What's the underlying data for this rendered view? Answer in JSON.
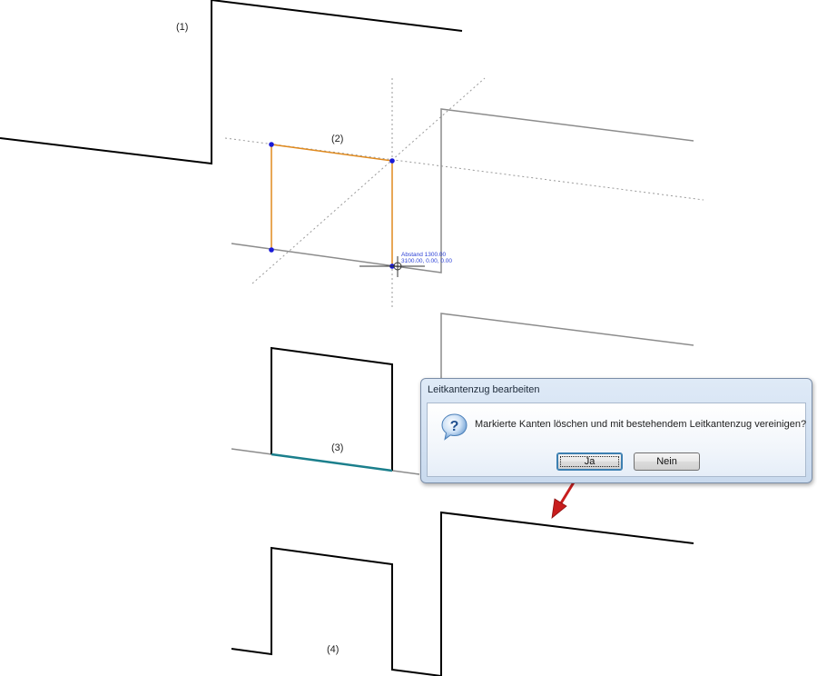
{
  "steps": {
    "step1": "(1)",
    "step2": "(2)",
    "step3": "(3)",
    "step4": "(4)"
  },
  "coordinate_tooltip": {
    "line1": "Abstand 1300.00",
    "line2": "3100.00, 0.00, 0.00"
  },
  "dialog": {
    "title": "Leitkantenzug bearbeiten",
    "message": "Markierte Kanten löschen und mit bestehendem Leitkantenzug vereinigen?",
    "icon": "question-icon",
    "yes_label": "Ja",
    "no_label": "Nein",
    "focused_button": "yes"
  },
  "colors": {
    "edge": "#000000",
    "reference_edge": "#8c8c8c",
    "selected_edge": "#e08a1e",
    "marked_edge": "#1b7f8c",
    "vertex": "#1a1ad8",
    "arrow": "#d32020",
    "tooltip_text": "#2a3fd6"
  }
}
